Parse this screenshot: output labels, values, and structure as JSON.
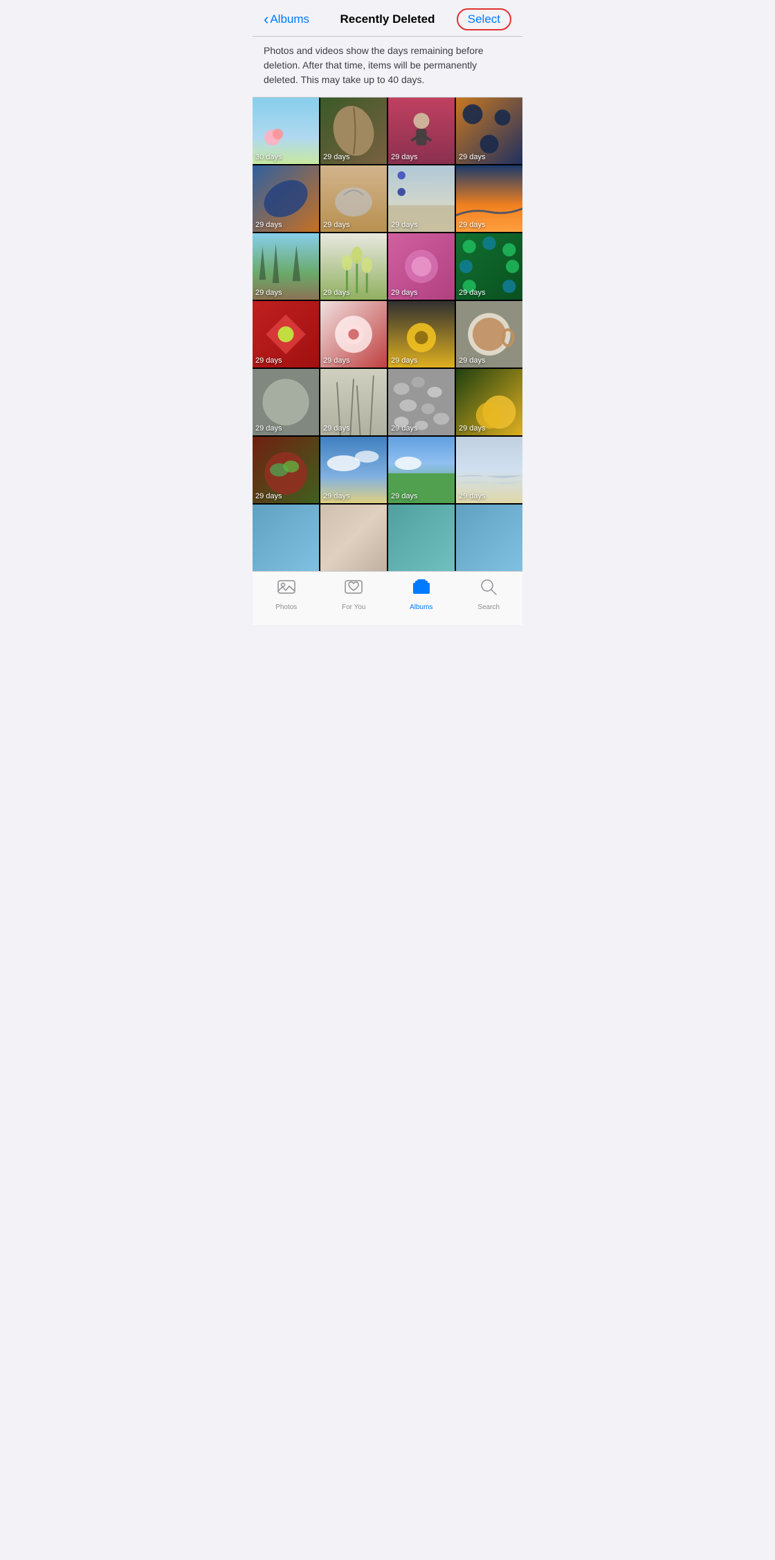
{
  "header": {
    "back_label": "Albums",
    "title": "Recently Deleted",
    "select_label": "Select"
  },
  "info": {
    "text": "Photos and videos show the days remaining before deletion. After that time, items will be permanently deleted. This may take up to 40 days."
  },
  "photos": [
    {
      "id": 1,
      "days": "30 days",
      "color_class": "photo-sky"
    },
    {
      "id": 2,
      "days": "29 days",
      "color_class": "photo-leaf"
    },
    {
      "id": 3,
      "days": "29 days",
      "color_class": "photo-child"
    },
    {
      "id": 4,
      "days": "29 days",
      "color_class": "photo-texture"
    },
    {
      "id": 5,
      "days": "29 days",
      "color_class": "photo-metal"
    },
    {
      "id": 6,
      "days": "29 days",
      "color_class": "photo-sand"
    },
    {
      "id": 7,
      "days": "29 days",
      "color_class": "photo-beach"
    },
    {
      "id": 8,
      "days": "29 days",
      "color_class": "photo-sunset"
    },
    {
      "id": 9,
      "days": "29 days",
      "color_class": "photo-trees"
    },
    {
      "id": 10,
      "days": "29 days",
      "color_class": "photo-tulips"
    },
    {
      "id": 11,
      "days": "29 days",
      "color_class": "photo-pink-flowers"
    },
    {
      "id": 12,
      "days": "29 days",
      "color_class": "photo-peacock"
    },
    {
      "id": 13,
      "days": "29 days",
      "color_class": "photo-red-flower"
    },
    {
      "id": 14,
      "days": "29 days",
      "color_class": "photo-white-flower"
    },
    {
      "id": 15,
      "days": "29 days",
      "color_class": "photo-yellow-flower"
    },
    {
      "id": 16,
      "days": "29 days",
      "color_class": "photo-coffee"
    },
    {
      "id": 17,
      "days": "29 days",
      "color_class": "photo-fern"
    },
    {
      "id": 18,
      "days": "29 days",
      "color_class": "photo-grass"
    },
    {
      "id": 19,
      "days": "29 days",
      "color_class": "photo-pebbles"
    },
    {
      "id": 20,
      "days": "29 days",
      "color_class": "photo-yellow-leaves"
    },
    {
      "id": 21,
      "days": "29 days",
      "color_class": "photo-salad"
    },
    {
      "id": 22,
      "days": "29 days",
      "color_class": "photo-sky2"
    },
    {
      "id": 23,
      "days": "29 days",
      "color_class": "photo-green-field"
    },
    {
      "id": 24,
      "days": "29 days",
      "color_class": "photo-coast"
    },
    {
      "id": 25,
      "days": "",
      "color_class": "photo-partial"
    },
    {
      "id": 26,
      "days": "",
      "color_class": "photo-partial2"
    },
    {
      "id": 27,
      "days": "",
      "color_class": "photo-partial3"
    },
    {
      "id": 28,
      "days": "",
      "color_class": "photo-partial"
    }
  ],
  "nav": {
    "items": [
      {
        "id": "photos",
        "label": "Photos",
        "icon": "📷",
        "active": false
      },
      {
        "id": "for-you",
        "label": "For You",
        "icon": "❤️",
        "active": false
      },
      {
        "id": "albums",
        "label": "Albums",
        "icon": "📁",
        "active": true
      },
      {
        "id": "search",
        "label": "Search",
        "icon": "🔍",
        "active": false
      }
    ]
  }
}
